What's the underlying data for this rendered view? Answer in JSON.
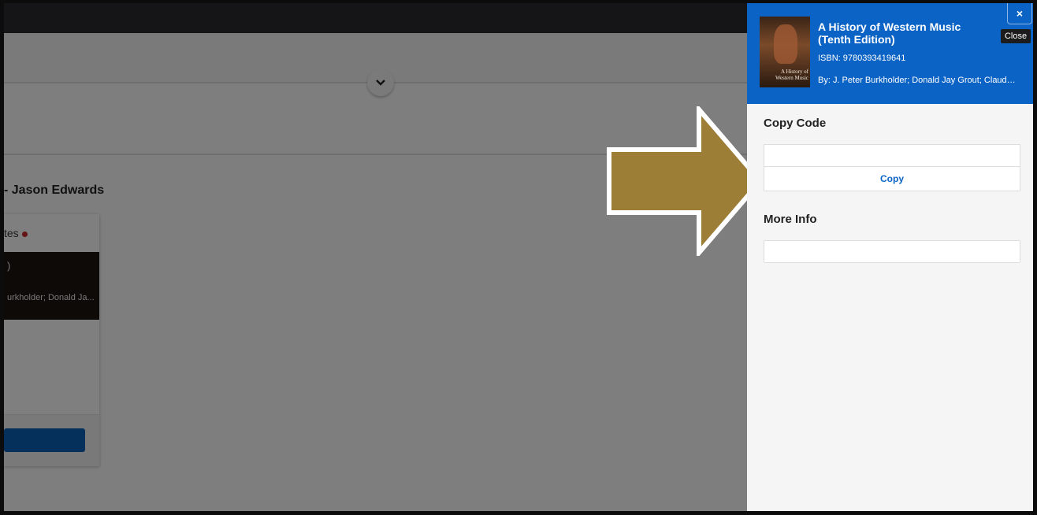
{
  "background": {
    "section_title": "- Jason Edwards",
    "card_heading": "tes",
    "card_book_partial": ")",
    "card_authors_partial": "urkholder; Donald Ja..."
  },
  "panel": {
    "book": {
      "title": "A History of Western Music (Tenth Edition)",
      "isbn": "ISBN: 9780393419641",
      "authors": "By: J. Peter Burkholder; Donald Jay Grout; Claude V. ...",
      "cover_text": "A History of Western Music"
    },
    "close_icon": "×",
    "close_tooltip": "Close",
    "copy_code_label": "Copy Code",
    "copy_code_value": "",
    "copy_button": "Copy",
    "more_info_label": "More Info",
    "more_info_value": ""
  },
  "colors": {
    "accent": "#0b63c5",
    "arrow": "#9c7e36",
    "topbar": "#2b2b31"
  }
}
